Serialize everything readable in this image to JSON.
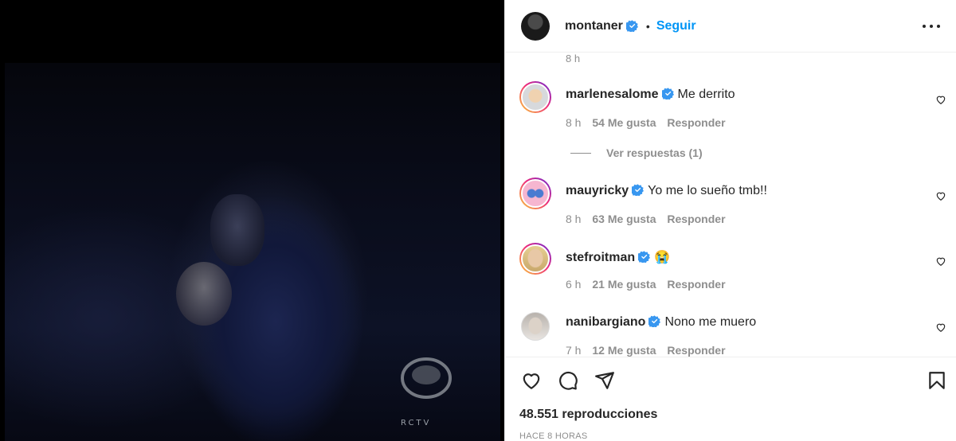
{
  "post": {
    "author": "montaner",
    "follow_label": "Seguir",
    "separator": "•",
    "top_time": "8 h"
  },
  "comments": [
    {
      "user": "marlenesalome",
      "text": "Me derrito",
      "time": "8 h",
      "likes": "54 Me gusta",
      "reply": "Responder",
      "replies_label": "Ver respuestas (1)"
    },
    {
      "user": "mauyricky",
      "text": "Yo me lo sueño tmb!!",
      "time": "8 h",
      "likes": "63 Me gusta",
      "reply": "Responder"
    },
    {
      "user": "stefroitman",
      "text": "😭",
      "time": "6 h",
      "likes": "21 Me gusta",
      "reply": "Responder"
    },
    {
      "user": "nanibargiano",
      "text": "Nono me muero",
      "time": "7 h",
      "likes": "12 Me gusta",
      "reply": "Responder"
    }
  ],
  "stats": {
    "views": "48.551 reproducciones",
    "posted": "HACE 8 HORAS"
  },
  "video": {
    "channel_watermark": "RCTV"
  },
  "colors": {
    "link": "#0095f6",
    "verified": "#3897f0",
    "muted": "#8e8e8e",
    "text": "#262626"
  },
  "icons": [
    "verified-badge-icon",
    "more-options-icon",
    "heart-icon",
    "comment-icon",
    "share-icon",
    "bookmark-icon"
  ]
}
